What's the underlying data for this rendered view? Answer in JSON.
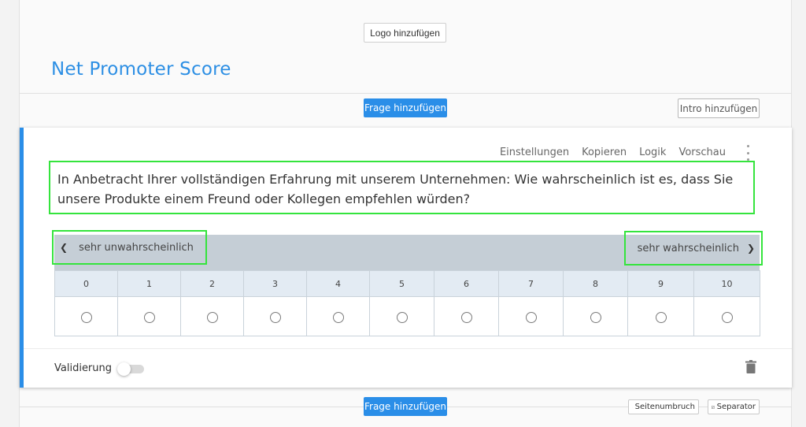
{
  "header": {
    "logo_button": "Logo hinzufügen",
    "survey_title": "Net Promoter Score"
  },
  "toolbar_top": {
    "add_question": "Frage hinzufügen",
    "add_intro": "Intro hinzufügen"
  },
  "question": {
    "actions": [
      "Einstellungen",
      "Kopieren",
      "Logik",
      "Vorschau"
    ],
    "text": "In Anbetracht Ihrer vollständigen Erfahrung mit unserem Unternehmen: Wie wahrscheinlich ist es, dass Sie unsere Produkte einem Freund oder Kollegen empfehlen würden?",
    "scale_left_label": "sehr unwahrscheinlich",
    "scale_right_label": "sehr wahrscheinlich",
    "scale_values": [
      "0",
      "1",
      "2",
      "3",
      "4",
      "5",
      "6",
      "7",
      "8",
      "9",
      "10"
    ],
    "validation_label": "Validierung",
    "validation_enabled": false
  },
  "toolbar_bottom": {
    "add_question": "Frage hinzufügen",
    "page_break": "Seitenumbruch",
    "separator": "Separator"
  },
  "colors": {
    "accent": "#2a8ee8",
    "highlight": "#35e43d",
    "scale_bar": "#c5ced6"
  }
}
